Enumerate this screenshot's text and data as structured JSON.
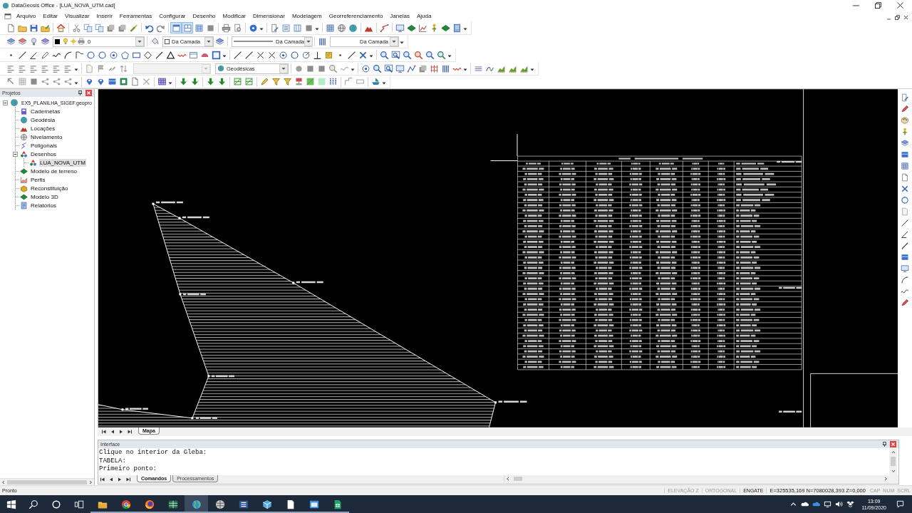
{
  "window": {
    "title": "DataGeosis Office - [LUA_NOVA_UTM.cad]"
  },
  "menu": [
    "Arquivo",
    "Editar",
    "Visualizar",
    "Inserir",
    "Ferramentas",
    "Configurar",
    "Desenho",
    "Modificar",
    "Dimensionar",
    "Modelagem",
    "Georreferenciamento",
    "Janelas",
    "Ajuda"
  ],
  "toolbars": {
    "view_buttons": [
      {
        "on": true
      },
      {
        "on": true
      },
      {
        "on": false
      },
      {
        "on": false
      }
    ],
    "layer_dropdown": {
      "value": "0"
    },
    "color_dropdown": {
      "value": "Da Camada"
    },
    "linetype_dropdown": {
      "value": "Da Camada"
    },
    "lineweight_dropdown": {
      "value": "Da Camada"
    },
    "blank_dropdown": {
      "disabled": true
    },
    "coordinate_dropdown": {
      "value": "Geodésicas"
    }
  },
  "projects_panel": {
    "title": "Projetos",
    "tree": [
      {
        "label": "EX5_PLANILHA_SIGEF.geopro",
        "expanded": true,
        "selected": false,
        "children": [
          {
            "label": "Cadernetas",
            "expanded": false,
            "selected": false
          },
          {
            "label": "Geodésia",
            "expanded": false,
            "selected": false
          },
          {
            "label": "Locações",
            "expanded": false,
            "selected": false
          },
          {
            "label": "Nivelamento",
            "expanded": false,
            "selected": false
          },
          {
            "label": "Poligonais",
            "expanded": false,
            "selected": false
          },
          {
            "label": "Desenhos",
            "expanded": true,
            "selected": false,
            "children": [
              {
                "label": "LUA_NOVA_UTM",
                "expanded": false,
                "selected": true
              }
            ]
          },
          {
            "label": "Modelo de terreno",
            "expanded": false,
            "selected": false
          },
          {
            "label": "Perfis",
            "expanded": false,
            "selected": false
          },
          {
            "label": "Reconstituição",
            "expanded": false,
            "selected": false
          },
          {
            "label": "Modelo 3D",
            "expanded": false,
            "selected": false
          },
          {
            "label": "Relatórios",
            "expanded": false,
            "selected": false
          }
        ]
      }
    ]
  },
  "drawing_tabs": [
    {
      "label": "Mapa",
      "selected": true
    }
  ],
  "interface_panel": {
    "title": "Interface",
    "lines": [
      "Clique no interior da Gleba:",
      "TABELA:",
      "Primeiro ponto:"
    ],
    "tabs": [
      {
        "label": "Comandos",
        "selected": true
      },
      {
        "label": "Processamentos",
        "selected": false
      }
    ]
  },
  "status_bar": {
    "message": "Pronto",
    "indicators": [
      {
        "label": "ELEVAÇÃO Z",
        "on": false
      },
      {
        "label": "ORTOGONAL",
        "on": false
      },
      {
        "label": "ENGATE",
        "on": true
      }
    ],
    "coordinates": "E=325535,169 N=7080028,393 Z=0,000",
    "keys": [
      {
        "label": "CAP",
        "on": false
      },
      {
        "label": "NUM",
        "on": false
      },
      {
        "label": "SCRL",
        "on": false
      }
    ]
  },
  "taskbar": {
    "apps": [
      {
        "active": false,
        "running": true
      },
      {
        "active": false,
        "running": true
      },
      {
        "active": false,
        "running": true
      },
      {
        "active": false,
        "running": true
      },
      {
        "active": true,
        "running": true
      },
      {
        "active": false,
        "running": true
      },
      {
        "active": false,
        "running": true
      },
      {
        "active": false,
        "running": true
      },
      {
        "active": false,
        "running": true
      },
      {
        "active": false,
        "running": true
      },
      {
        "active": false,
        "running": true
      }
    ],
    "time": "13:09",
    "date": "11/09/2020"
  }
}
